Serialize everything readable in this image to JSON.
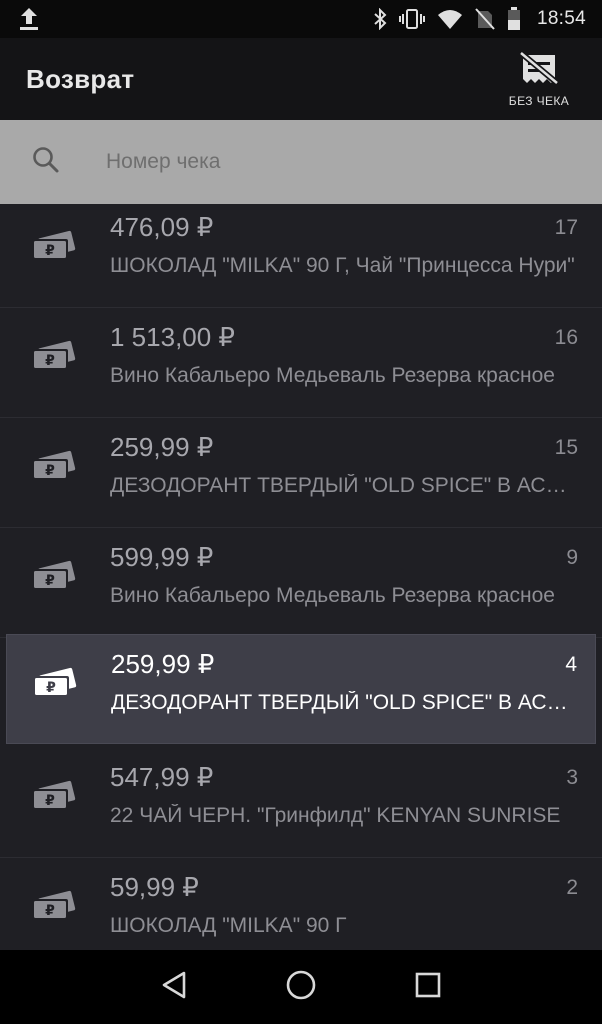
{
  "status_bar": {
    "time": "18:54",
    "icons": [
      "upload-icon",
      "bluetooth-icon",
      "vibrate-icon",
      "wifi-icon",
      "no-sim-icon",
      "battery-icon"
    ]
  },
  "app_bar": {
    "title": "Возврат",
    "no_receipt_label": "БЕЗ ЧЕКА",
    "no_receipt_icon": "receipt-off-icon"
  },
  "search": {
    "placeholder": "Номер чека",
    "value": "",
    "icon": "search-icon"
  },
  "receipts": [
    {
      "amount": "476,09 ₽",
      "number": "17",
      "description": " ШОКОЛАД \"MILKA\"  90 Г, Чай \"Принцесса Нури\"",
      "selected": false
    },
    {
      "amount": "1 513,00 ₽",
      "number": "16",
      "description": "Вино Кабальеро Медьеваль Резерва красное",
      "selected": false
    },
    {
      "amount": "259,99 ₽",
      "number": "15",
      "description": "ДЕЗОДОРАНТ ТВЕРДЫЙ \"OLD SPICE\" В АССОРТИМЕНТЕ",
      "selected": false
    },
    {
      "amount": "599,99 ₽",
      "number": "9",
      "description": "Вино Кабальеро Медьеваль Резерва красное",
      "selected": false
    },
    {
      "amount": "259,99 ₽",
      "number": "4",
      "description": "ДЕЗОДОРАНТ ТВЕРДЫЙ \"OLD SPICE\" В АССОРТИМЕНТЕ",
      "selected": true
    },
    {
      "amount": "547,99 ₽",
      "number": "3",
      "description": "22 ЧАЙ ЧЕРН. \"Гринфилд\" KENYAN SUNRISE",
      "selected": false
    },
    {
      "amount": "59,99 ₽",
      "number": "2",
      "description": " ШОКОЛАД \"MILKA\"  90 Г",
      "selected": false
    }
  ],
  "nav_bar": {
    "icons": [
      "back-icon",
      "home-icon",
      "recents-icon"
    ]
  },
  "colors": {
    "list_background": "#1f1f24",
    "selected_row": "#3e3e48",
    "search_background": "#a9a9a9",
    "app_bar": "#141416"
  }
}
